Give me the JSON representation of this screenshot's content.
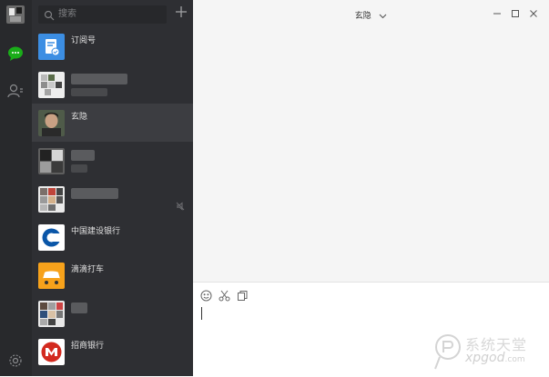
{
  "search": {
    "placeholder": "搜索"
  },
  "chat": {
    "title": "玄隐"
  },
  "conversations": [
    {
      "name": "订阅号",
      "avatar": "subscription-icon"
    },
    {
      "name": "",
      "avatar": "group-avatar"
    },
    {
      "name": "玄隐",
      "avatar": "person-avatar",
      "selected": true
    },
    {
      "name": "",
      "avatar": "group-avatar"
    },
    {
      "name": "",
      "avatar": "group-avatar",
      "muted": true
    },
    {
      "name": "中国建设银行",
      "avatar": "ccb-logo"
    },
    {
      "name": "滴滴打车",
      "avatar": "didi-logo"
    },
    {
      "name": "",
      "avatar": "group-avatar"
    },
    {
      "name": "招商银行",
      "avatar": "cmb-logo"
    }
  ],
  "watermark": {
    "text": "系统天堂",
    "sub": "xpgod",
    "domain": ".com"
  },
  "colors": {
    "accent_green": "#1aad19",
    "rail_bg": "#28292c",
    "list_bg": "#2e2f33",
    "selected_bg": "#3c3d41"
  }
}
